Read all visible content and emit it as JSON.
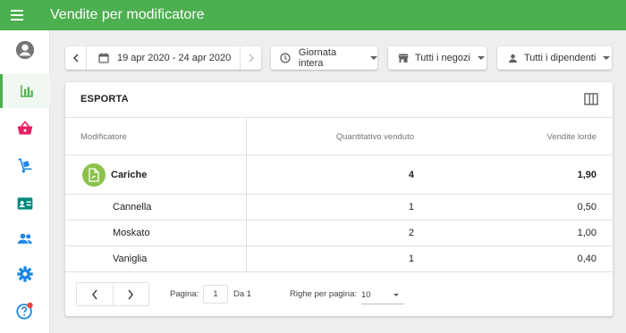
{
  "app": {
    "title": "Vendite per modificatore"
  },
  "sidebar": {
    "items": [
      {
        "icon": "account-icon"
      },
      {
        "icon": "reports-icon",
        "active": true
      },
      {
        "icon": "items-basket-icon"
      },
      {
        "icon": "inventory-icon"
      },
      {
        "icon": "customers-card-icon"
      },
      {
        "icon": "employees-icon"
      },
      {
        "icon": "settings-icon"
      },
      {
        "icon": "help-icon"
      }
    ]
  },
  "filters": {
    "date_range": "19 apr 2020 - 24 apr 2020",
    "time": "Giornata intera",
    "stores": "Tutti i negozi",
    "employees": "Tutti i dipendenti"
  },
  "card": {
    "export_label": "ESPORTA"
  },
  "table": {
    "headers": [
      "Modificatore",
      "Quantitativo venduto",
      "Vendite lorde"
    ],
    "group": {
      "name": "Cariche",
      "qty": "4",
      "gross": "1,90"
    },
    "rows": [
      {
        "name": "Cannella",
        "qty": "1",
        "gross": "0,50"
      },
      {
        "name": "Moskato",
        "qty": "2",
        "gross": "1,00"
      },
      {
        "name": "Vaniglia",
        "qty": "1",
        "gross": "0,40"
      }
    ]
  },
  "pagination": {
    "page_label": "Pagina:",
    "page_value": "1",
    "of_label": "Da 1",
    "rows_label": "Righe per pagina:",
    "rows_value": "10"
  },
  "colors": {
    "primary": "#4caf50",
    "badge": "#8bc34a",
    "notification": "#f44336",
    "basket": "#e91e63",
    "icon": "#1e88e5",
    "card-icon": "#00897b"
  }
}
